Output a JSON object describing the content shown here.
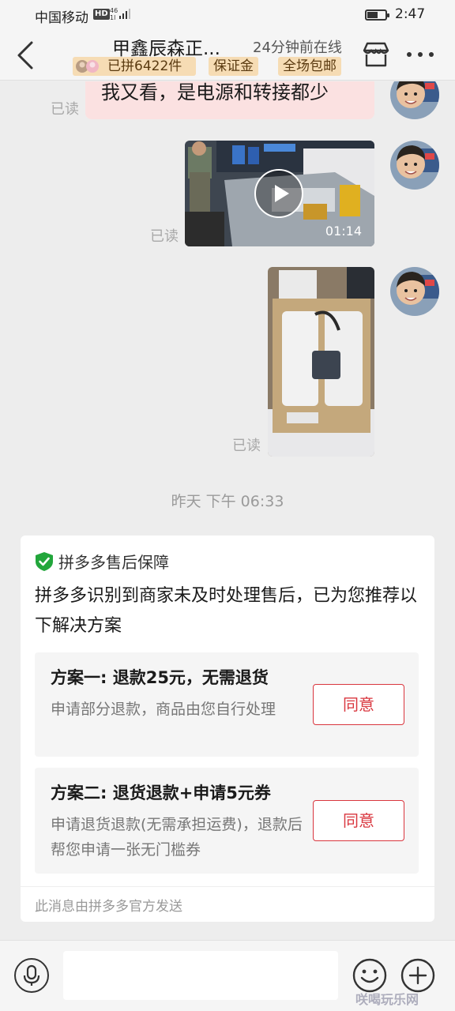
{
  "status_bar": {
    "carrier": "中国移动",
    "hd_label": "HD",
    "network": "46",
    "network_sub": "1l",
    "time": "2:47",
    "battery_level": 0.6
  },
  "header": {
    "shop_name": "甲鑫辰森正...",
    "online_status": "24分钟前在线",
    "tags": [
      "已拼6422件",
      "保证金",
      "全场包邮"
    ]
  },
  "messages": {
    "read_label": "已读",
    "text_1": "我又看，是电源和转接都少",
    "video_duration": "01:14",
    "timestamp": "昨天 下午 06:33"
  },
  "service_card": {
    "title": "拼多多售后保障",
    "body": "拼多多识别到商家未及时处理售后，已为您推荐以下解决方案",
    "plans": [
      {
        "title": "方案一: 退款25元，无需退货",
        "desc": "申请部分退款，商品由您自行处理",
        "button": "同意"
      },
      {
        "title": "方案二: 退货退款+申请5元券",
        "desc": "申请退货退款(无需承担运费)，退款后帮您申请一张无门槛券",
        "button": "同意"
      }
    ],
    "footer": "此消息由拼多多官方发送"
  },
  "input_bar": {
    "placeholder": ""
  },
  "watermark": "咲喝玩乐网",
  "colors": {
    "accent_red": "#d9363e",
    "tag_bg": "#f6dcb4",
    "bubble_pink": "#fbe1e1",
    "shield_green": "#22a63b"
  }
}
